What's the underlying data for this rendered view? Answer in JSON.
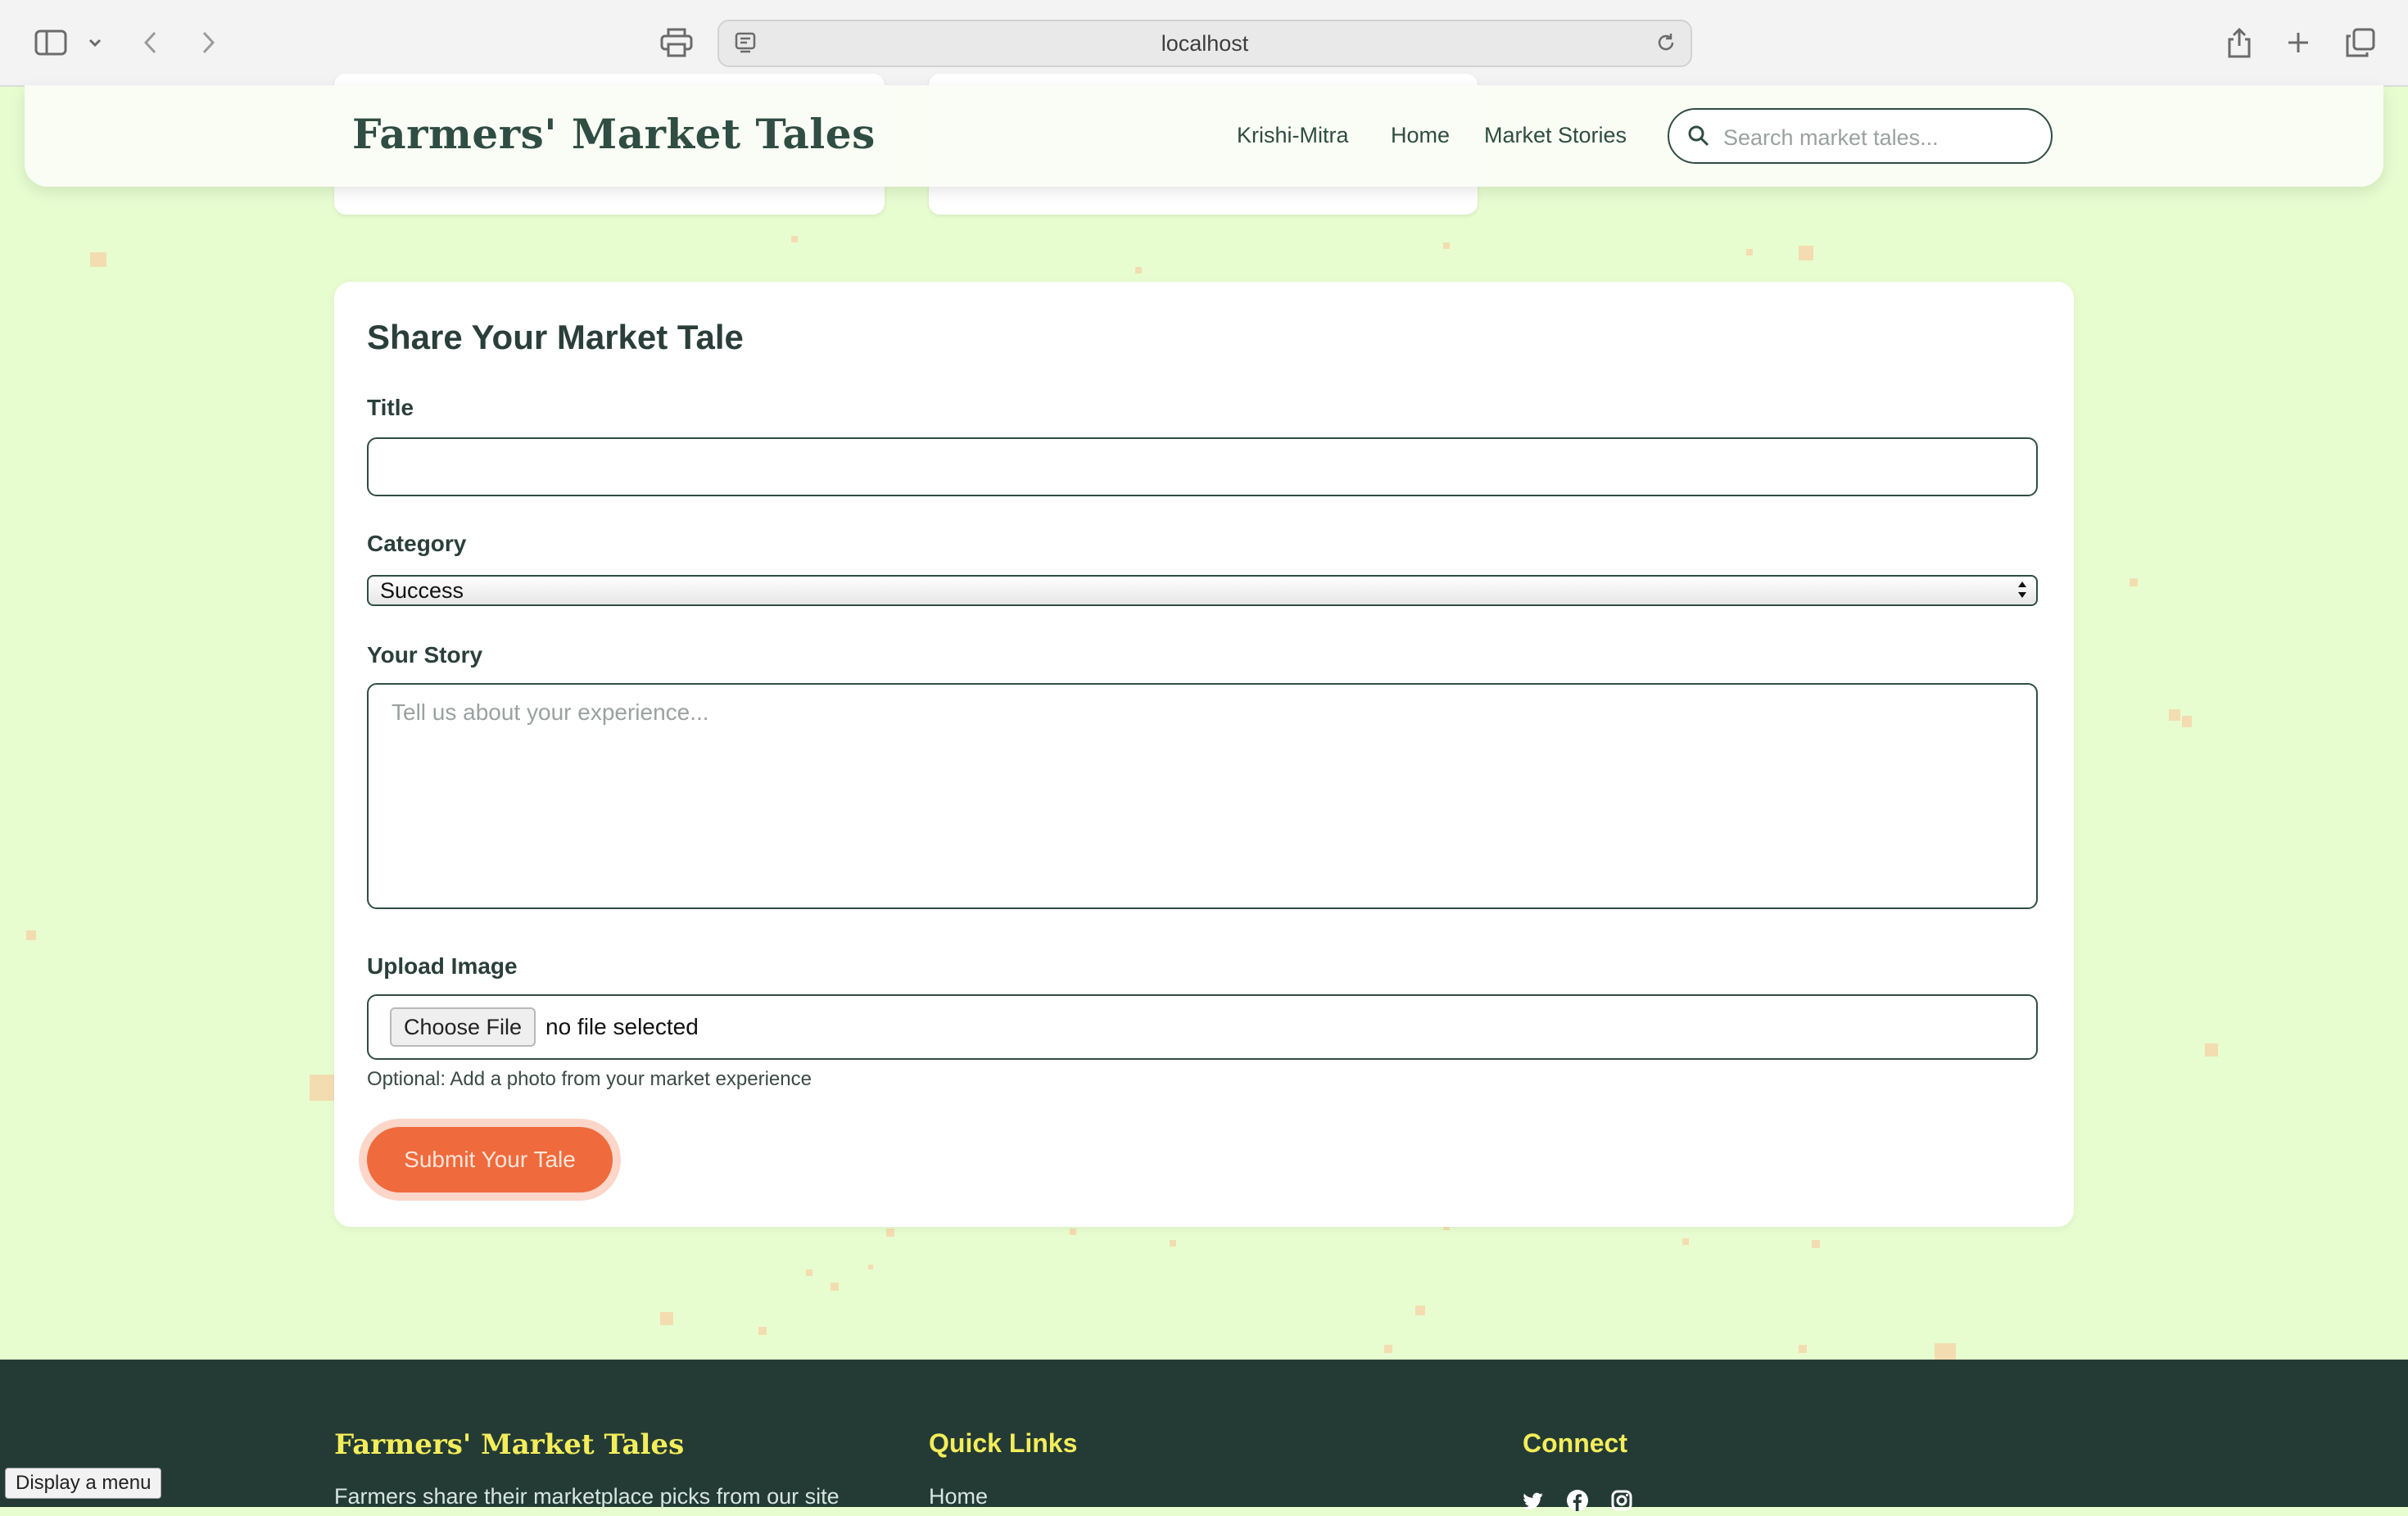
{
  "browser": {
    "url": "localhost",
    "icons": [
      "sidebar-icon",
      "chevron-down-icon",
      "back-icon",
      "forward-icon",
      "print-icon",
      "site-settings-icon",
      "reload-icon",
      "share-icon",
      "new-tab-icon",
      "tabs-overview-icon"
    ]
  },
  "header": {
    "brand": "Farmers' Market Tales",
    "nav": [
      "Krishi-Mitra",
      "Home",
      "Market Stories"
    ],
    "search_placeholder": "Search market tales..."
  },
  "form": {
    "title": "Share Your Market Tale",
    "title_label": "Title",
    "title_value": "",
    "category_label": "Category",
    "category_selected": "Success",
    "story_label": "Your Story",
    "story_placeholder": "Tell us about your experience...",
    "upload_label": "Upload Image",
    "choose_file": "Choose File",
    "file_status": "no file selected",
    "hint": "Optional: Add a photo from your market experience",
    "submit": "Submit Your Tale"
  },
  "footer": {
    "brand": "Farmers' Market Tales",
    "blurb": "Farmers share their marketplace picks from our site",
    "quick_links_title": "Quick Links",
    "quick_links": [
      "Home"
    ],
    "connect_title": "Connect",
    "social_icons": [
      "twitter-icon",
      "facebook-icon",
      "instagram-icon"
    ]
  },
  "tooltip": "Display a menu",
  "colors": {
    "page_bg": "#e7fdd0",
    "accent": "#ef6a3c",
    "footer_bg": "#243b35",
    "footer_heading": "#f4ed5a",
    "text_dark": "#2b3f3a"
  }
}
